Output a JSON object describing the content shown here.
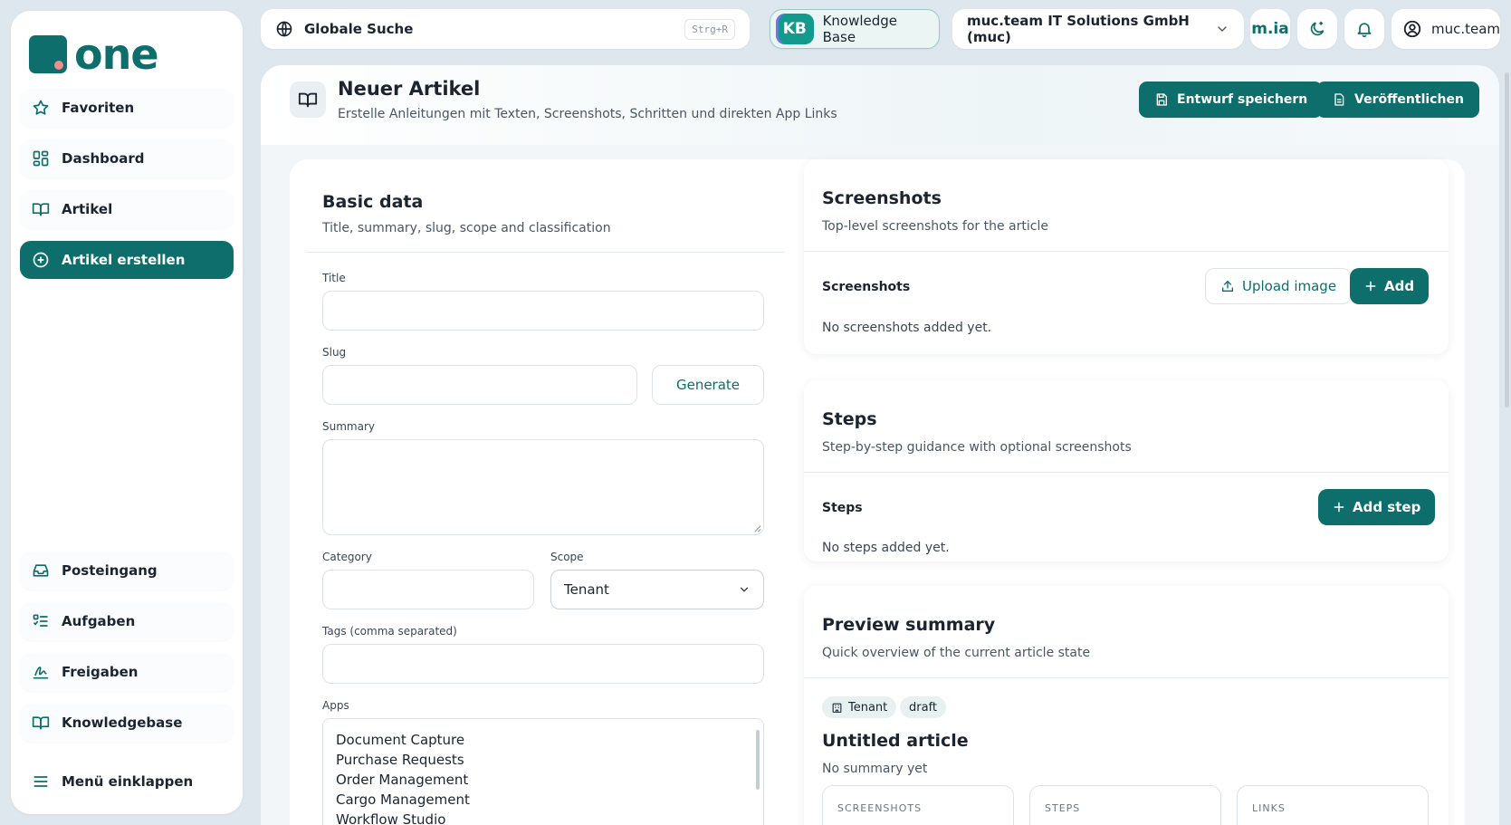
{
  "app": {
    "logo_text": "one",
    "accent_color": "#0d6e6b"
  },
  "sidebar": {
    "items": [
      {
        "label": "Favoriten",
        "icon": "star-icon"
      },
      {
        "label": "Dashboard",
        "icon": "dashboard-icon"
      },
      {
        "label": "Artikel",
        "icon": "book-icon"
      },
      {
        "label": "Artikel erstellen",
        "icon": "plus-circle-icon",
        "active": true
      }
    ],
    "bottom_items": [
      {
        "label": "Posteingang",
        "icon": "inbox-icon"
      },
      {
        "label": "Aufgaben",
        "icon": "tasks-icon"
      },
      {
        "label": "Freigaben",
        "icon": "signature-icon"
      },
      {
        "label": "Knowledgebase",
        "icon": "book-icon"
      }
    ],
    "collapse_label": "Menü einklappen"
  },
  "topbar": {
    "search_label": "Globale Suche",
    "search_shortcut": "Strg+R",
    "kb_badge": "KB",
    "kb_label": "Knowledge Base",
    "tenant_label": "muc.team IT Solutions GmbH (muc)",
    "mia_label": "m.ia",
    "user_label": "muc.team"
  },
  "page": {
    "title": "Neuer Artikel",
    "subtitle": "Erstelle Anleitungen mit Texten, Screenshots, Schritten und direkten App Links",
    "save_draft_label": "Entwurf speichern",
    "publish_label": "Veröffentlichen"
  },
  "basic_data": {
    "title": "Basic data",
    "subtitle": "Title, summary, slug, scope and classification",
    "title_label": "Title",
    "title_value": "",
    "slug_label": "Slug",
    "slug_value": "",
    "generate_label": "Generate",
    "summary_label": "Summary",
    "summary_value": "",
    "category_label": "Category",
    "category_value": "",
    "scope_label": "Scope",
    "scope_value": "Tenant",
    "tags_label": "Tags (comma separated)",
    "tags_value": "",
    "apps_label": "Apps",
    "apps": [
      "Document Capture",
      "Purchase Requests",
      "Order Management",
      "Cargo Management",
      "Workflow Studio"
    ]
  },
  "screenshots": {
    "title": "Screenshots",
    "subtitle": "Top-level screenshots for the article",
    "row_label": "Screenshots",
    "upload_label": "Upload image",
    "add_label": "Add",
    "empty_text": "No screenshots added yet."
  },
  "steps": {
    "title": "Steps",
    "subtitle": "Step-by-step guidance with optional screenshots",
    "row_label": "Steps",
    "add_label": "Add step",
    "empty_text": "No steps added yet."
  },
  "preview": {
    "title": "Preview summary",
    "subtitle": "Quick overview of the current article state",
    "chip_scope": "Tenant",
    "chip_status": "draft",
    "article_title": "Untitled article",
    "article_summary": "No summary yet",
    "stats": [
      "SCREENSHOTS",
      "STEPS",
      "LINKS"
    ]
  }
}
